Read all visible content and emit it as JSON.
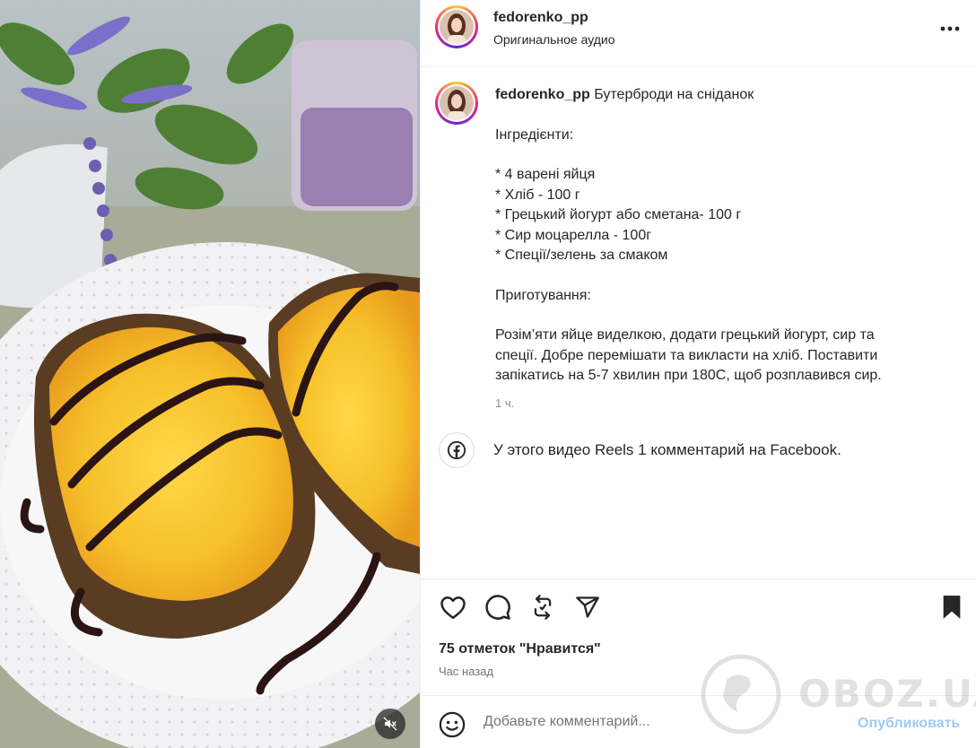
{
  "header": {
    "username": "fedorenko_pp",
    "audio": "Оригинальное аудио",
    "more_icon": "more-horizontal-icon"
  },
  "caption": {
    "username": "fedorenko_pp",
    "title": "Бутерброди на сніданок",
    "lines": [
      "Інгредієнти:",
      "",
      "* 4 варені яйця",
      "* Хліб - 100 г",
      "* Грецький йогурт або сметана- 100 г",
      "* Сир моцарелла - 100г",
      "* Спеції/зелень за смаком",
      "",
      "Приготування:",
      "",
      "Розім’яти яйце виделкою, додати грецький йогурт, сир та",
      "спеції. Добре перемішати та викласти на хліб. Поставити",
      "запікатись на 5-7 хвилин при 180С, щоб розплавився сир."
    ],
    "time": "1 ч."
  },
  "facebook": {
    "icon": "facebook-icon",
    "text": "У этого видео Reels 1 комментарий на Facebook."
  },
  "actions": {
    "icons": [
      "heart-icon",
      "comment-icon",
      "repost-icon",
      "share-icon",
      "bookmark-icon"
    ],
    "likes": "75 отметок \"Нравится\"",
    "ago": "Час назад"
  },
  "comment": {
    "placeholder": "Добавьте комментарий...",
    "publish": "Опубликовать"
  },
  "watermark": "OBOZ.UA",
  "media": {
    "mute_icon": "speaker-muted-icon"
  }
}
